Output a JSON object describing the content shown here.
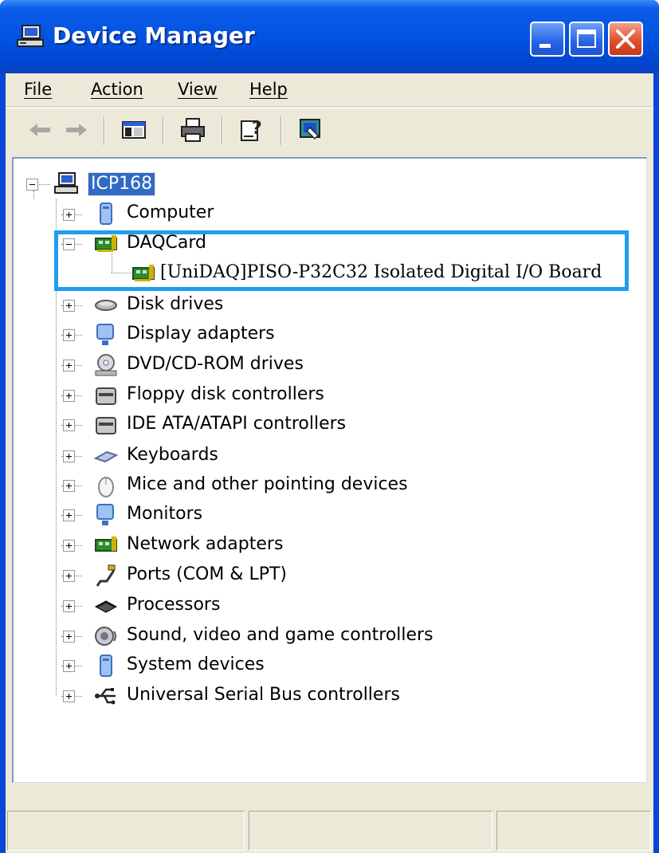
{
  "window": {
    "title": "Device Manager"
  },
  "menu": [
    "File",
    "Action",
    "View",
    "Help"
  ],
  "toolbar": [
    "back-icon",
    "forward-icon",
    "show-hide-console-tree-icon",
    "print-icon",
    "help-icon",
    "properties-icon"
  ],
  "tree": {
    "root": "ICP168",
    "categories": [
      {
        "label": "Computer",
        "icon": "computer-icon",
        "expanded": false
      },
      {
        "label": "DAQCard",
        "icon": "network-card-icon",
        "expanded": true,
        "children": [
          "[UniDAQ]PISO-P32C32 Isolated Digital I/O Board"
        ]
      },
      {
        "label": "Disk drives",
        "icon": "disk-drive-icon",
        "expanded": false
      },
      {
        "label": "Display adapters",
        "icon": "display-adapter-icon",
        "expanded": false
      },
      {
        "label": "DVD/CD-ROM drives",
        "icon": "cdrom-icon",
        "expanded": false
      },
      {
        "label": "Floppy disk controllers",
        "icon": "floppy-controller-icon",
        "expanded": false
      },
      {
        "label": "IDE ATA/ATAPI controllers",
        "icon": "ide-controller-icon",
        "expanded": false
      },
      {
        "label": "Keyboards",
        "icon": "keyboard-icon",
        "expanded": false
      },
      {
        "label": "Mice and other pointing devices",
        "icon": "mouse-icon",
        "expanded": false
      },
      {
        "label": "Monitors",
        "icon": "monitor-icon",
        "expanded": false
      },
      {
        "label": "Network adapters",
        "icon": "network-adapter-icon",
        "expanded": false
      },
      {
        "label": "Ports (COM & LPT)",
        "icon": "port-icon",
        "expanded": false
      },
      {
        "label": "Processors",
        "icon": "processor-icon",
        "expanded": false
      },
      {
        "label": "Sound, video and game controllers",
        "icon": "sound-icon",
        "expanded": false
      },
      {
        "label": "System devices",
        "icon": "system-device-icon",
        "expanded": false
      },
      {
        "label": "Universal Serial Bus controllers",
        "icon": "usb-icon",
        "expanded": false
      }
    ]
  },
  "colors": {
    "title_bar": "#0052e0",
    "selection": "#316ac5",
    "highlight_box": "#1f9ef0",
    "chrome": "#ece9d8"
  }
}
